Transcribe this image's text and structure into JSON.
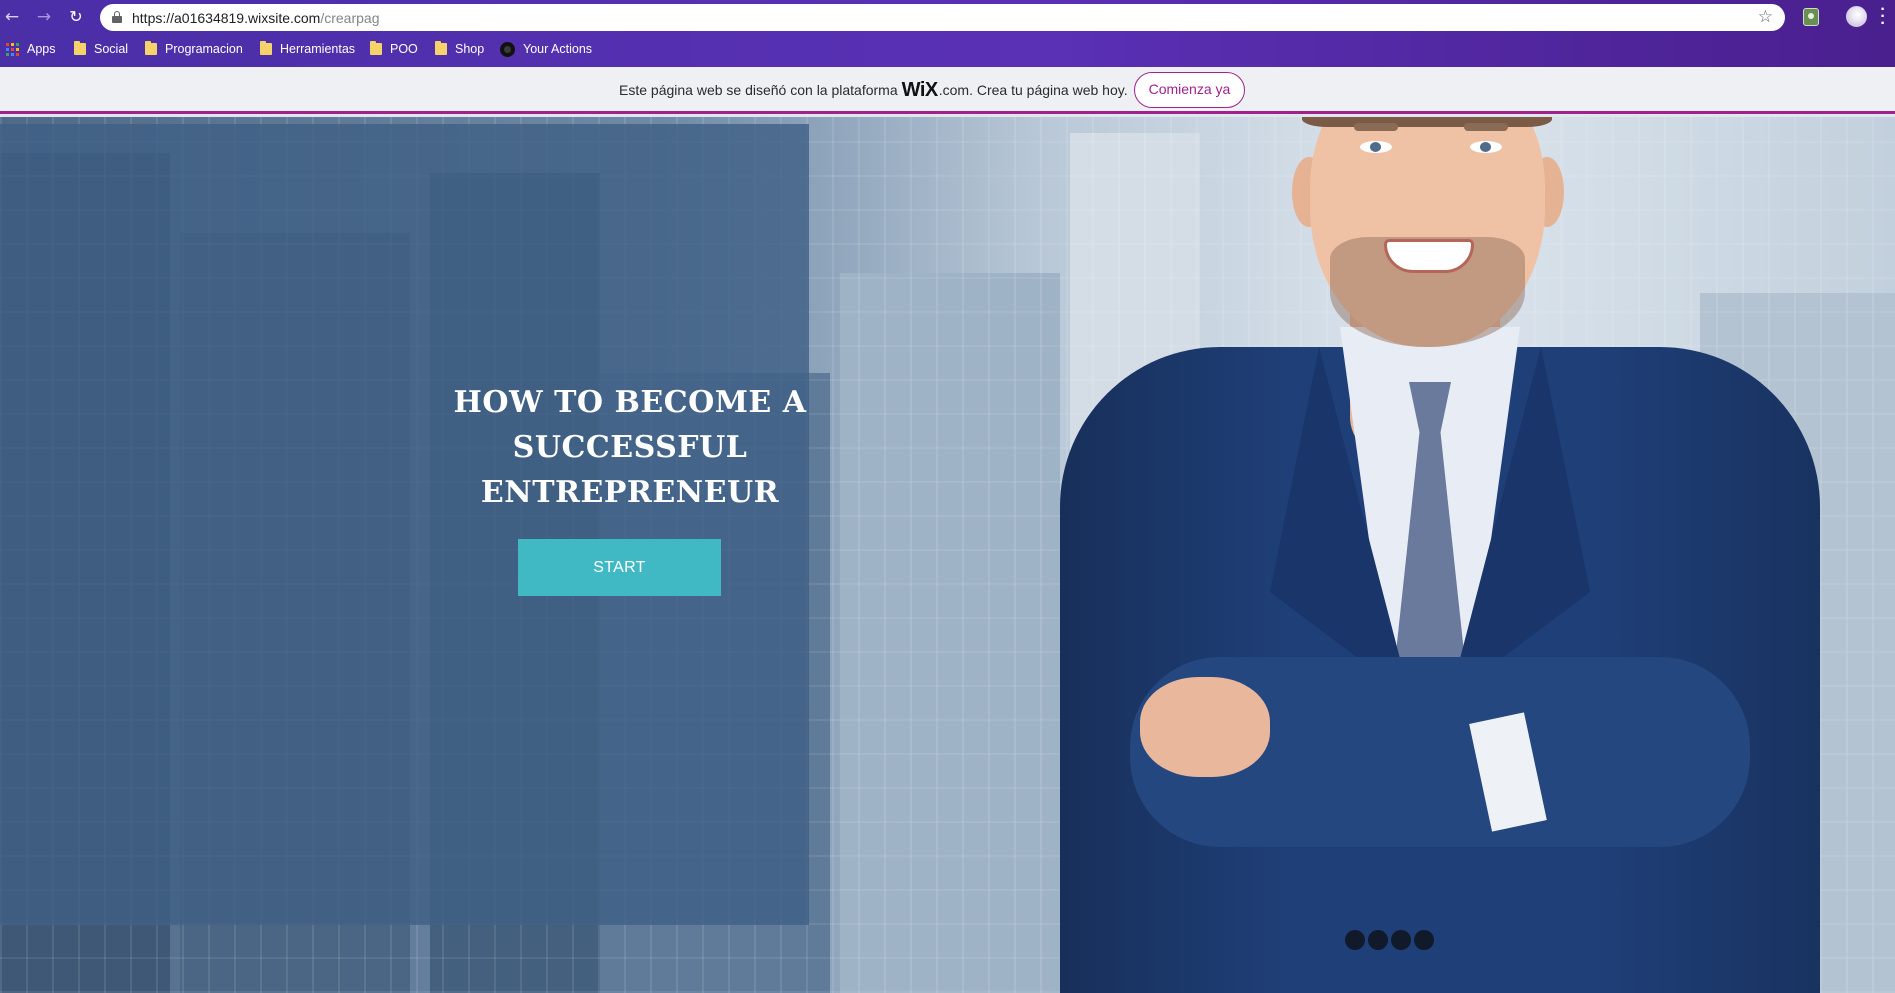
{
  "browser": {
    "url_host": "https://a01634819.wixsite.com",
    "url_path": "/crearpag",
    "back_icon": "arrow-left",
    "forward_icon": "arrow-right",
    "reload_icon": "reload",
    "bookmarks": [
      {
        "label": "Apps",
        "icon": "apps-grid"
      },
      {
        "label": "Social",
        "icon": "folder"
      },
      {
        "label": "Programacion",
        "icon": "folder"
      },
      {
        "label": "Herramientas",
        "icon": "folder"
      },
      {
        "label": "POO",
        "icon": "folder"
      },
      {
        "label": "Shop",
        "icon": "folder"
      },
      {
        "label": "Your Actions",
        "icon": "github"
      }
    ]
  },
  "wix_banner": {
    "text_before": "Este página web se diseñó con la plataforma ",
    "logo": "WiX",
    "text_after": ".com. Crea tu página web hoy.",
    "cta": "Comienza ya",
    "accent_color": "#a1218d"
  },
  "hero": {
    "headline": "HOW TO BECOME A SUCCESSFUL ENTREPRENEUR",
    "button": "START",
    "button_color": "#41b9c4",
    "panel_color": "#3e5f85"
  }
}
